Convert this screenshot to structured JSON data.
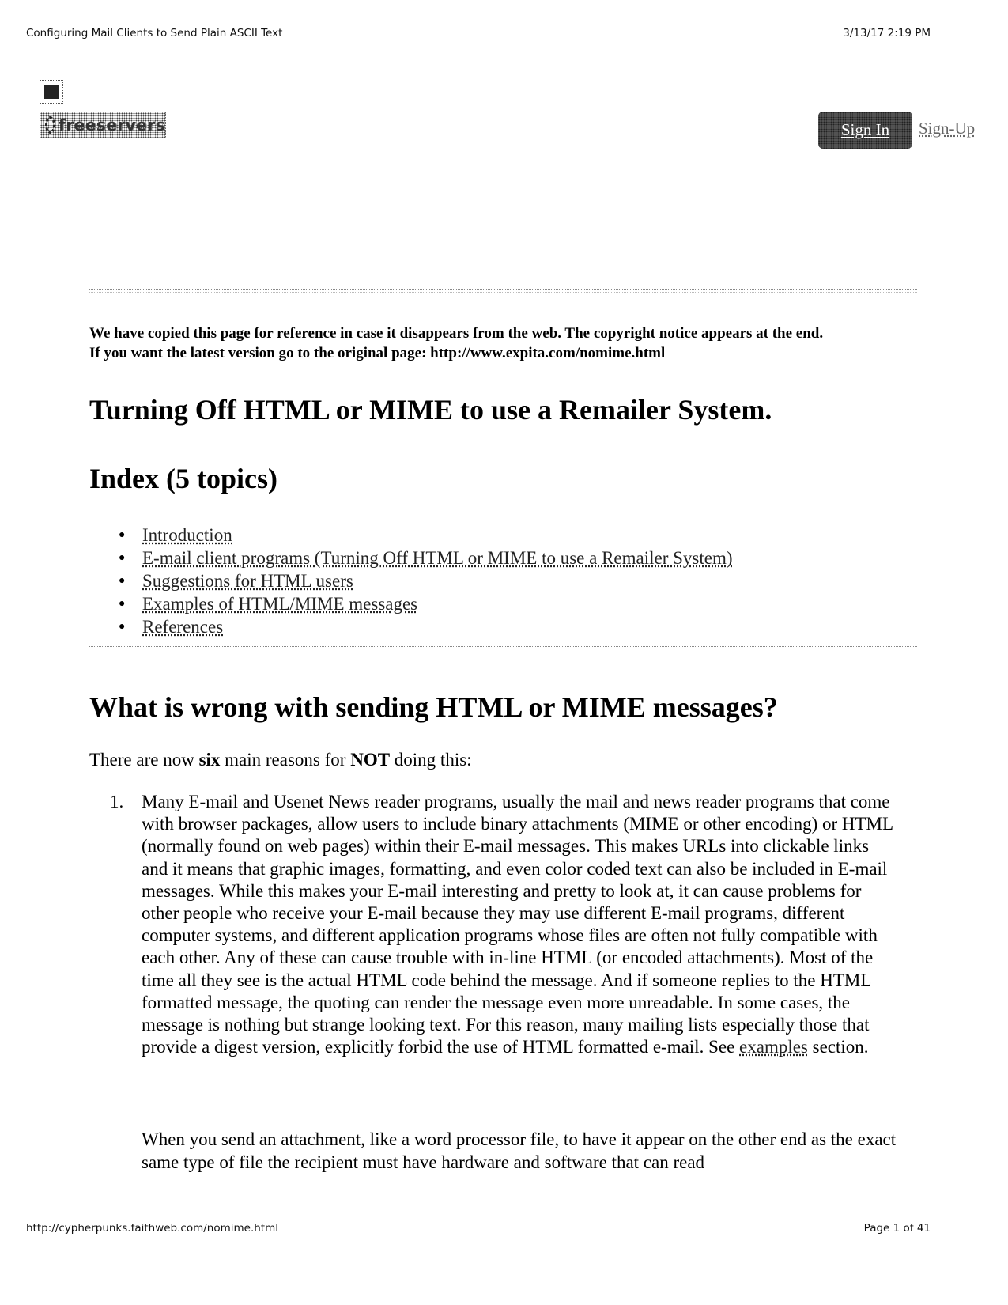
{
  "print_header": {
    "title": "Configuring Mail Clients to Send Plain ASCII Text",
    "datetime": "3/13/17 2:19 PM"
  },
  "print_footer": {
    "url": "http://cypherpunks.faithweb.com/nomime.html",
    "page": "Page 1 of 41"
  },
  "site_header": {
    "logo_text": "freeservers",
    "sign_in_label": "Sign In",
    "sign_up_label": "Sign-Up"
  },
  "notice": {
    "line1": "We have copied this page for reference in case it disappears from the web. The copyright notice appears at the end.",
    "line2": "If you want the latest version go to the original page: http://www.expita.com/nomime.html"
  },
  "title": "Turning Off HTML or MIME to use a Remailer System.",
  "index": {
    "heading": "Index (5 topics)",
    "items": [
      "Introduction",
      "E-mail client programs (Turning Off HTML or MIME to use a Remailer System)",
      "Suggestions for HTML users",
      "Examples of HTML/MIME messages",
      "References"
    ]
  },
  "section": {
    "heading": "What is wrong with sending HTML or MIME messages?",
    "intro": {
      "before": "There are now ",
      "bold1": "six",
      "middle": " main reasons for ",
      "bold2": "NOT",
      "after": " doing this:"
    },
    "reasons": [
      {
        "number": "1.",
        "text_before_link": "Many E-mail and Usenet News reader programs, usually the mail and news reader programs that come with browser packages, allow users to include binary attachments (MIME or other encoding) or HTML (normally found on web pages) within their E-mail messages. This makes URLs into clickable links and it means that graphic images, formatting, and even color coded text can also be included in E-mail messages. While this makes your E-mail interesting and pretty to look at, it can cause problems for other people who receive your E-mail because they may use different E-mail programs, different computer systems, and different application programs whose files are often not fully compatible with each other. Any of these can cause trouble with in-line HTML (or encoded attachments). Most of the time all they see is the actual HTML code behind the message. And if someone replies to the HTML formatted message, the quoting can render the message even more unreadable. In some cases, the message is nothing but strange looking text. For this reason, many mailing lists especially those that provide a digest version, explicitly forbid the use of HTML formatted e-mail. See ",
        "link": "examples",
        "text_after_link": " section."
      }
    ],
    "paragraph2": "When you send an attachment, like a word processor file, to have it appear on the other end as the exact same type of file the recipient must have hardware and software that can read"
  }
}
